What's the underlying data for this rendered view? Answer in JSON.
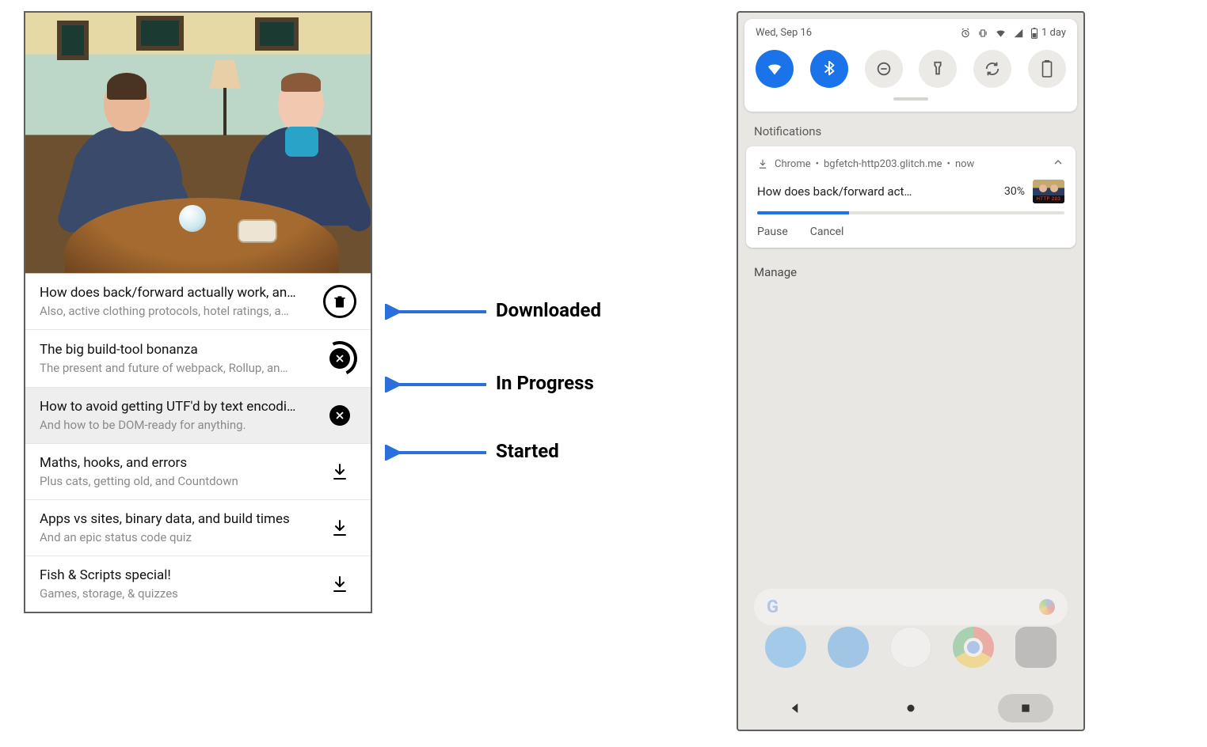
{
  "annotations": {
    "downloaded": "Downloaded",
    "in_progress": "In Progress",
    "started": "Started"
  },
  "left": {
    "episodes": [
      {
        "title": "How does back/forward actually work, an…",
        "subtitle": "Also, active clothing protocols, hotel ratings, a…",
        "state": "downloaded"
      },
      {
        "title": "The big build-tool bonanza",
        "subtitle": "The present and future of webpack, Rollup, an…",
        "state": "in_progress"
      },
      {
        "title": "How to avoid getting UTF'd by text encodi…",
        "subtitle": "And how to be DOM-ready for anything.",
        "state": "started",
        "selected": true
      },
      {
        "title": "Maths, hooks, and errors",
        "subtitle": "Plus cats, getting old, and Countdown",
        "state": "idle"
      },
      {
        "title": "Apps vs sites, binary data, and build times",
        "subtitle": "And an epic status code quiz",
        "state": "idle"
      },
      {
        "title": "Fish & Scripts special!",
        "subtitle": "Games, storage, & quizzes",
        "state": "idle"
      }
    ]
  },
  "right": {
    "status_date": "Wed, Sep 16",
    "status_battery": "1 day",
    "notifications_label": "Notifications",
    "notif": {
      "app": "Chrome",
      "source": "bgfetch-http203.glitch.me",
      "time": "now",
      "title": "How does back/forward act…",
      "percent_text": "30%",
      "percent_value": 30,
      "thumb_tag": "HTTP 203",
      "actions": {
        "pause": "Pause",
        "cancel": "Cancel"
      }
    },
    "manage": "Manage"
  }
}
